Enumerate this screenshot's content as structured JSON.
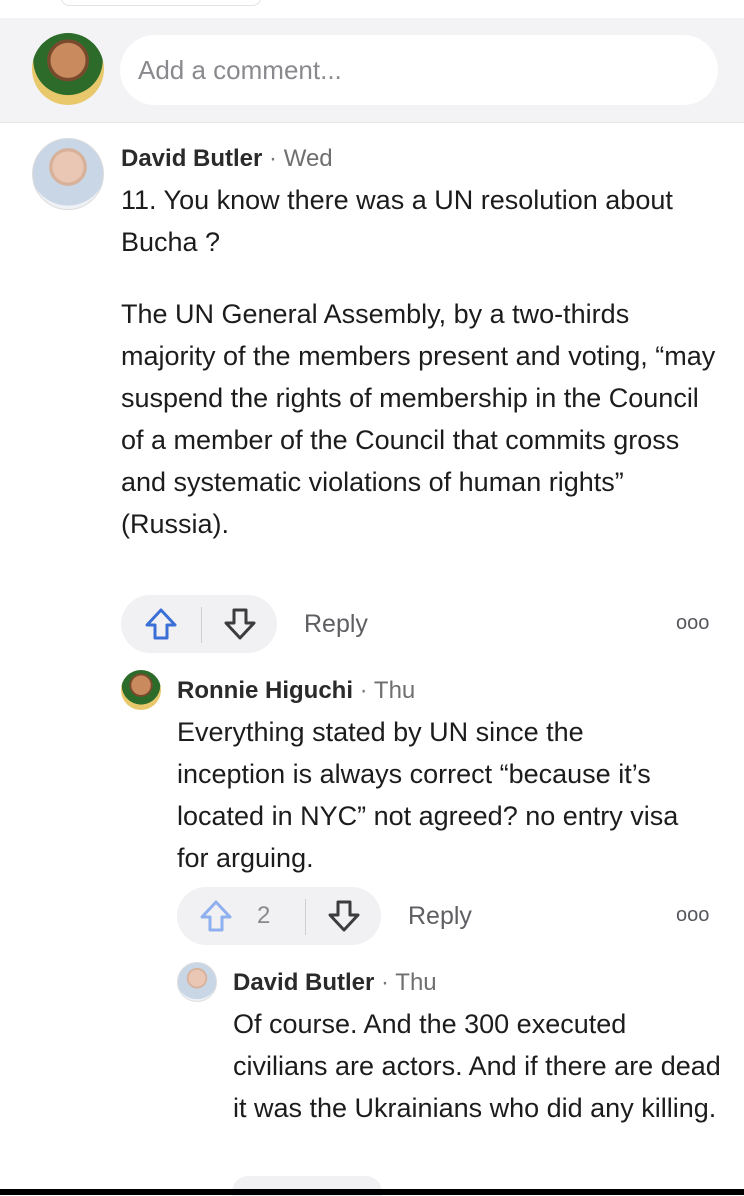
{
  "composer": {
    "placeholder": "Add a comment..."
  },
  "comments": [
    {
      "author": "David Butler",
      "separator": "·",
      "time": "Wed",
      "paragraphs": [
        "11. You know there was a UN resolution about Bucha ?",
        "The UN General Assembly, by a two-thirds majority of the members present and voting, “may suspend the rights of membership in the Council of a member of the Council that commits gross and systematic violations of human rights” (Russia)."
      ],
      "reply_label": "Reply",
      "more_label": "ooo"
    },
    {
      "author": "Ronnie Higuchi",
      "separator": "·",
      "time": "Thu",
      "paragraphs": [
        "Everything stated by UN since the inception is always correct “because it’s located in NYC” not agreed? no entry visa for arguing."
      ],
      "upvotes": "2",
      "reply_label": "Reply",
      "more_label": "ooo"
    },
    {
      "author": "David Butler",
      "separator": "·",
      "time": "Thu",
      "paragraphs": [
        "Of course. And the 300 executed civilians are actors. And if there are dead it was the Ukrainians who did any killing."
      ]
    }
  ],
  "icons": {
    "upvote": "arrow-up-outline-icon",
    "downvote": "arrow-down-outline-icon",
    "more": "more-dots-icon"
  },
  "colors": {
    "upvote_active": "#3b6fd8",
    "upvote_light": "#8fb0ee",
    "downvote": "#3c3c3c"
  }
}
